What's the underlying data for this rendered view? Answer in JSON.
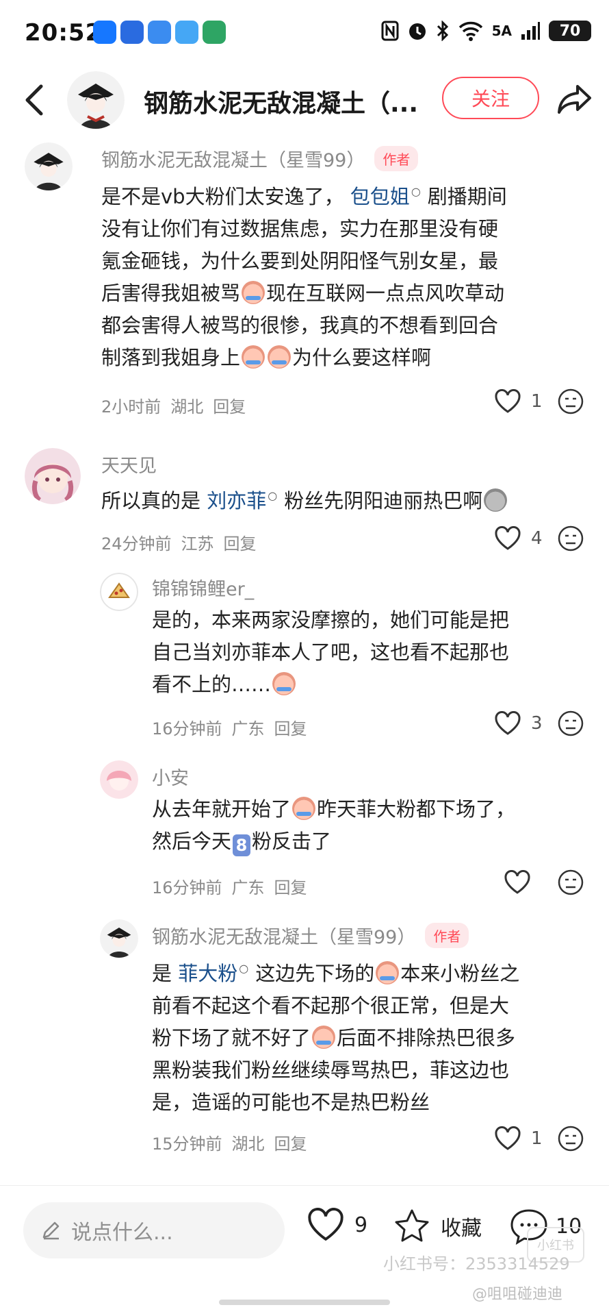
{
  "status_bar": {
    "time": "20:52",
    "network": "5G",
    "signal_label": "5A",
    "battery": "70"
  },
  "header": {
    "title": "钢筋水泥无敌混凝土（...",
    "follow_label": "关注"
  },
  "comments": [
    {
      "name": "钢筋水泥无敌混凝土（星雪99）",
      "tag": "作者",
      "seg": [
        "是不是vb大粉们太安逸了，",
        "包包姐",
        "剧播期间",
        "没有让你们有过数据焦虑，实力在那里没有硬",
        "氪金砸钱，为什么要到处阴阳怪气别女星，最",
        "后害得我姐被骂",
        "现在互联网一点点风吹草动",
        "都会害得人被骂的很惨，我真的不想看到回合",
        "制落到我姐身上",
        "为什么要这样啊"
      ],
      "time": "2小时前",
      "location": "湖北",
      "reply": "回复",
      "likes": "1"
    },
    {
      "name": "天天见",
      "seg": [
        "所以真的是",
        "刘亦菲",
        "粉丝先阴阳迪丽热巴啊"
      ],
      "time": "24分钟前",
      "location": "江苏",
      "reply": "回复",
      "likes": "4"
    },
    {
      "name": "锦锦锦鲤er_",
      "seg": [
        "是的，本来两家没摩擦的，她们可能是把",
        "自己当刘亦菲本人了吧，这也看不起那也",
        "看不上的……"
      ],
      "time": "16分钟前",
      "location": "广东",
      "reply": "回复",
      "likes": "3"
    },
    {
      "name": "小安",
      "seg": [
        "从去年就开始了",
        "昨天菲大粉都下场了，",
        "然后今天",
        "8",
        "粉反击了"
      ],
      "time": "16分钟前",
      "location": "广东",
      "reply": "回复",
      "likes": ""
    },
    {
      "name": "钢筋水泥无敌混凝土（星雪99）",
      "tag": "作者",
      "seg": [
        "是",
        "菲大粉",
        "这边先下场的",
        "本来小粉丝之",
        "前看不起这个看不起那个很正常，但是大",
        "粉下场了就不好了",
        "后面不排除热巴很多",
        "黑粉装我们粉丝继续辱骂热巴，菲这边也",
        "是，造谣的可能也不是热巴粉丝"
      ],
      "time": "15分钟前",
      "location": "湖北",
      "reply": "回复",
      "likes": "1"
    }
  ],
  "bottom_bar": {
    "input_placeholder": "说点什么...",
    "like_count": "9",
    "favorite_label": "收藏",
    "comment_count": "10",
    "watermark_id": "小红书号：2353314529",
    "watermark_weibo": "@咀咀碰迪迪",
    "watermark_logo": "小红书"
  },
  "colors": {
    "accent": "#ff4a57",
    "mention": "#1a4f8b",
    "meta": "#8a8a8a"
  }
}
